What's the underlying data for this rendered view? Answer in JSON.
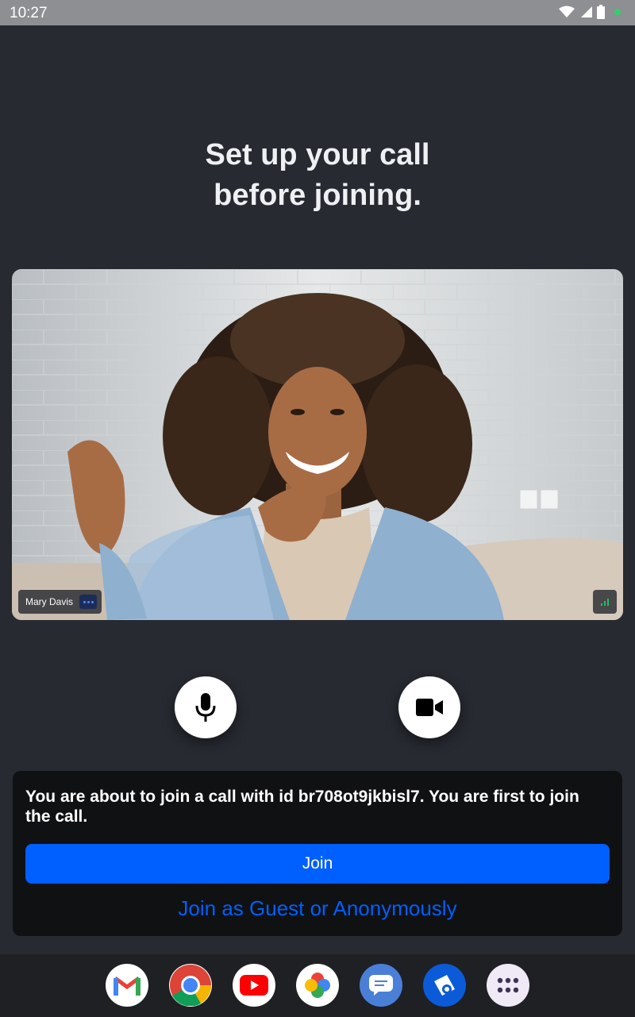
{
  "status_bar": {
    "time": "10:27"
  },
  "heading": {
    "line1": "Set up your call",
    "line2": "before joining."
  },
  "preview": {
    "participant_name": "Mary Davis"
  },
  "controls": {
    "mic_icon": "microphone-icon",
    "camera_icon": "video-camera-icon"
  },
  "join": {
    "message": "You are about to join a call with id br708ot9jkbisl7. You are first to join the call.",
    "join_label": "Join",
    "guest_label": "Join as Guest or Anonymously",
    "accent_color": "#005fff"
  },
  "dock": {
    "apps": [
      "gmail-icon",
      "chrome-icon",
      "youtube-icon",
      "photos-icon",
      "messages-icon",
      "stream-video-icon",
      "app-drawer-icon"
    ]
  }
}
